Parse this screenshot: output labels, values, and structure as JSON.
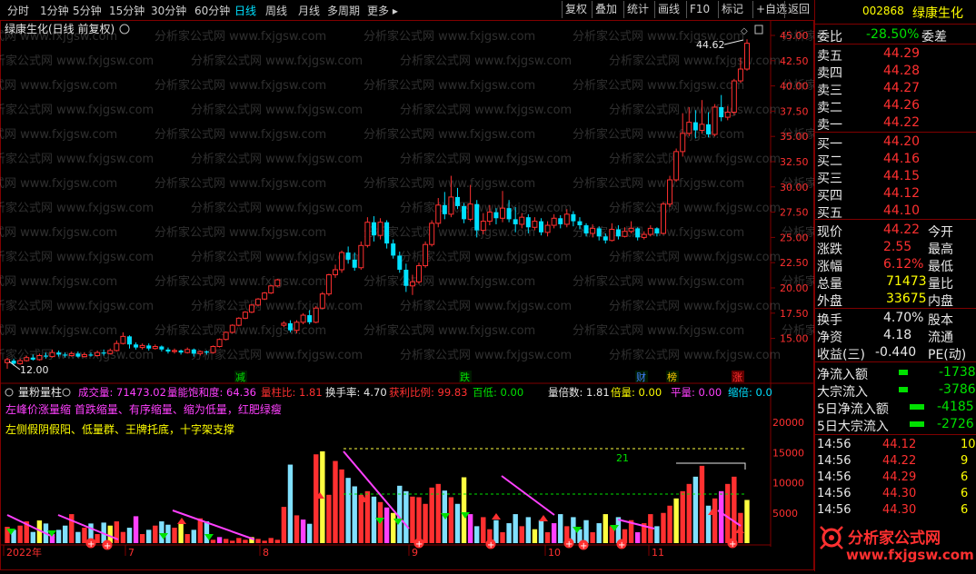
{
  "toolbar": {
    "periods": [
      "分时",
      "1分钟",
      "5分钟",
      "15分钟",
      "30分钟",
      "60分钟",
      "日线",
      "周线",
      "月线",
      "多周期",
      "更多 ▸"
    ],
    "active_period": "日线",
    "right_buttons": [
      "复权",
      "叠加",
      "统计",
      "画线",
      "F10",
      "标记",
      "+自选",
      "返回"
    ]
  },
  "chart_header": {
    "title": "绿康生化(日线 前复权)"
  },
  "price_axis": {
    "ticks": [
      "45.00",
      "42.50",
      "40.00",
      "37.50",
      "35.00",
      "32.50",
      "30.00",
      "27.50",
      "25.00",
      "22.50",
      "20.00",
      "17.50",
      "15.00"
    ]
  },
  "annotations": {
    "high_label": "44.62",
    "low_label": "12.00",
    "events": [
      "减",
      "跌",
      "财",
      "榜",
      "涨"
    ]
  },
  "indicator": {
    "name": "量粉量柱",
    "stats": [
      {
        "label": "成交量:",
        "value": "71473.02",
        "color": "#ff40ff"
      },
      {
        "label": "量能饱和度:",
        "value": "64.36",
        "color": "#ff40ff"
      },
      {
        "label": "量柱比:",
        "value": "1.81",
        "color": "#ff3030"
      },
      {
        "label": "换手率:",
        "value": "4.70",
        "color": "#e8e8e8"
      },
      {
        "label": "获利比例:",
        "value": "99.83",
        "color": "#ff3030"
      },
      {
        "label": "百低:",
        "value": "0.00",
        "color": "#00e000"
      },
      {
        "label": "量倍数:",
        "value": "1.81",
        "color": "#e8e8e8"
      },
      {
        "label": "倍量:",
        "value": "0.00",
        "color": "#ffff00"
      },
      {
        "label": "平量:",
        "value": "0.00",
        "color": "#ff40ff"
      },
      {
        "label": "缩倍:",
        "value": "0.0",
        "color": "#00e0ff"
      }
    ],
    "line1": "左峰价涨量缩 首跌缩量、有序缩量、缩为低量，红肥绿瘦",
    "line2": "左侧假阴假阳、低量群、王牌托底，十字架支撑",
    "axis_ticks": [
      "20000",
      "15000",
      "10000",
      "5000"
    ],
    "level_label": "21"
  },
  "date_axis": {
    "labels": [
      "2022年",
      "7",
      "8",
      "9",
      "10",
      "11"
    ]
  },
  "quote": {
    "code": "002868",
    "name": "绿康生化",
    "weibi_label": "委比",
    "weibi_value": "-28.50%",
    "weicha_label": "委差",
    "asks": [
      {
        "label": "卖五",
        "price": "44.29"
      },
      {
        "label": "卖四",
        "price": "44.28"
      },
      {
        "label": "卖三",
        "price": "44.27"
      },
      {
        "label": "卖二",
        "price": "44.26"
      },
      {
        "label": "卖一",
        "price": "44.22"
      }
    ],
    "bids": [
      {
        "label": "买一",
        "price": "44.20"
      },
      {
        "label": "买二",
        "price": "44.16"
      },
      {
        "label": "买三",
        "price": "44.15"
      },
      {
        "label": "买四",
        "price": "44.12"
      },
      {
        "label": "买五",
        "price": "44.10"
      }
    ],
    "stats": [
      {
        "label": "现价",
        "value": "44.22",
        "label2": "今开"
      },
      {
        "label": "涨跌",
        "value": "2.55",
        "label2": "最高"
      },
      {
        "label": "涨幅",
        "value": "6.12%",
        "label2": "最低"
      },
      {
        "label": "总量",
        "value": "71473",
        "label2": "量比"
      },
      {
        "label": "外盘",
        "value": "33675",
        "label2": "内盘"
      }
    ],
    "stats2": [
      {
        "label": "换手",
        "value": "4.70%",
        "label2": "股本"
      },
      {
        "label": "净资",
        "value": "4.18",
        "label2": "流通"
      },
      {
        "label": "收益(三)",
        "value": "-0.440",
        "label2": "PE(动)"
      }
    ],
    "flows": [
      {
        "label": "净流入额",
        "value": "-1738"
      },
      {
        "label": "大宗流入",
        "value": "-3786"
      },
      {
        "label": "5日净流入额",
        "value": "-4185"
      },
      {
        "label": "5日大宗流入",
        "value": "-2726"
      }
    ],
    "ticks": [
      {
        "time": "14:56",
        "price": "44.12",
        "vol": "10"
      },
      {
        "time": "14:56",
        "price": "44.22",
        "vol": "9"
      },
      {
        "time": "14:56",
        "price": "44.29",
        "vol": "6"
      },
      {
        "time": "14:56",
        "price": "44.30",
        "vol": "6"
      },
      {
        "time": "14:56",
        "price": "44.30",
        "vol": "6"
      }
    ]
  },
  "watermark": {
    "text": "分析家公式网",
    "url": "www.fxjgsw.com"
  },
  "colors": {
    "up": "#ff3030",
    "down": "#00e0ff",
    "frame": "#800000",
    "magenta": "#ff40ff"
  }
}
